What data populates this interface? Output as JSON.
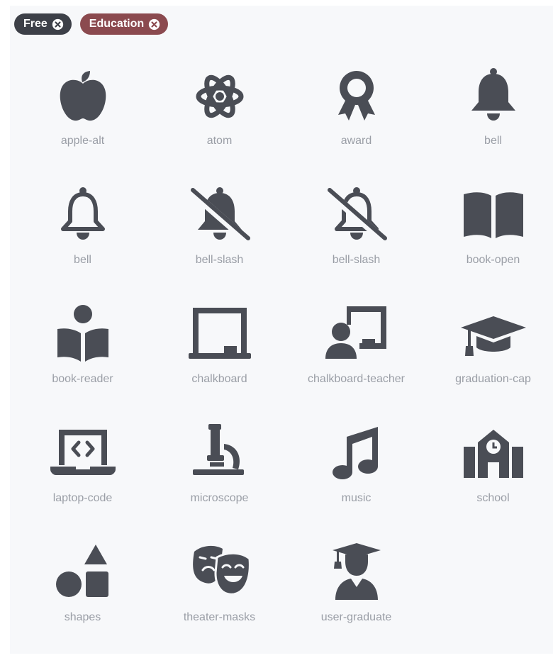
{
  "colors": {
    "icon": "#4a4d55",
    "label": "#9a9ea6",
    "chip_free_bg": "#3d4048",
    "chip_education_bg": "#8b4a4f",
    "panel_bg": "#f7f8fa"
  },
  "filters": [
    {
      "label": "Free",
      "icon": "close-circle-icon"
    },
    {
      "label": "Education",
      "icon": "close-circle-icon"
    }
  ],
  "icons": [
    {
      "name": "apple-alt",
      "icon": "apple-icon"
    },
    {
      "name": "atom",
      "icon": "atom-icon"
    },
    {
      "name": "award",
      "icon": "award-icon"
    },
    {
      "name": "bell",
      "icon": "bell-solid-icon"
    },
    {
      "name": "bell",
      "icon": "bell-outline-icon"
    },
    {
      "name": "bell-slash",
      "icon": "bell-slash-solid-icon"
    },
    {
      "name": "bell-slash",
      "icon": "bell-slash-outline-icon"
    },
    {
      "name": "book-open",
      "icon": "book-open-icon"
    },
    {
      "name": "book-reader",
      "icon": "book-reader-icon"
    },
    {
      "name": "chalkboard",
      "icon": "chalkboard-icon"
    },
    {
      "name": "chalkboard-teacher",
      "icon": "chalkboard-teacher-icon"
    },
    {
      "name": "graduation-cap",
      "icon": "graduation-cap-icon"
    },
    {
      "name": "laptop-code",
      "icon": "laptop-code-icon"
    },
    {
      "name": "microscope",
      "icon": "microscope-icon"
    },
    {
      "name": "music",
      "icon": "music-icon"
    },
    {
      "name": "school",
      "icon": "school-icon"
    },
    {
      "name": "shapes",
      "icon": "shapes-icon"
    },
    {
      "name": "theater-masks",
      "icon": "theater-masks-icon"
    },
    {
      "name": "user-graduate",
      "icon": "user-graduate-icon"
    }
  ]
}
